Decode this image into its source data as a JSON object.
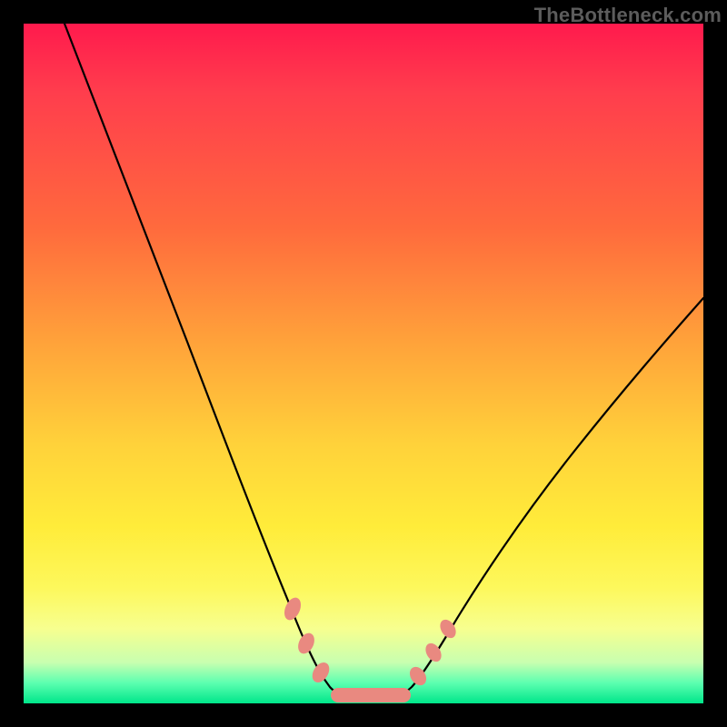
{
  "watermark": "TheBottleneck.com",
  "colors": {
    "curve": "#000000",
    "marker_fill": "#e98980",
    "marker_stroke": "#d6766d",
    "gradient_top": "#ff1a4d",
    "gradient_bottom": "#00e68a"
  },
  "chart_data": {
    "type": "line",
    "title": "",
    "xlabel": "",
    "ylabel": "",
    "xlim": [
      0,
      100
    ],
    "ylim": [
      0,
      100
    ],
    "note": "No axis ticks or numeric labels are rendered; values are estimated from pixel positions on a 0–100 normalized scale (origin at bottom-left of colored plot area). The curve is a V-shape with a flat minimum near y≈2 around x≈43–55.",
    "series": [
      {
        "name": "curve",
        "x": [
          6,
          10,
          15,
          20,
          25,
          30,
          35,
          38,
          40,
          42,
          44,
          46,
          48,
          50,
          52,
          54,
          56,
          58,
          62,
          68,
          75,
          82,
          90,
          98
        ],
        "y": [
          100,
          90,
          79,
          67,
          55,
          43,
          31,
          22,
          16,
          10,
          5,
          3,
          2,
          2,
          2,
          3,
          5,
          8,
          15,
          24,
          34,
          43,
          52,
          60
        ]
      }
    ],
    "markers": {
      "name": "highlight-dots",
      "shape": "rounded-pill",
      "x": [
        39.5,
        41.5,
        44,
        48,
        52,
        55.5,
        57.5,
        59.5
      ],
      "y": [
        14,
        9,
        4,
        2,
        2,
        4,
        8,
        13
      ]
    }
  }
}
